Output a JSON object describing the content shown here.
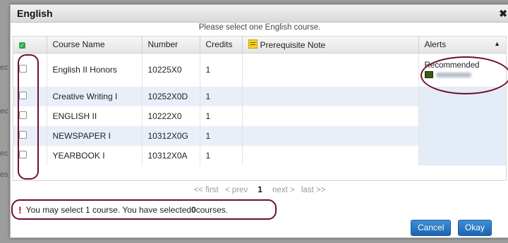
{
  "dialog": {
    "title": "English",
    "close_symbol": "✖",
    "instruction": "Please select one English course."
  },
  "table": {
    "headers": {
      "course_name": "Course Name",
      "number": "Number",
      "credits": "Credits",
      "prerequisite_note": "Prerequisite Note",
      "alerts": "Alerts"
    },
    "rows": [
      {
        "name": "English II Honors",
        "number": "10225X0",
        "credits": "1",
        "checked": false,
        "alert": "Recommended"
      },
      {
        "name": "Creative Writing I",
        "number": "10252X0D",
        "credits": "1",
        "checked": false,
        "alert": ""
      },
      {
        "name": "ENGLISH II",
        "number": "10222X0",
        "credits": "1",
        "checked": false,
        "alert": ""
      },
      {
        "name": "NEWSPAPER I",
        "number": "10312X0G",
        "credits": "1",
        "checked": false,
        "alert": ""
      },
      {
        "name": "YEARBOOK I",
        "number": "10312X0A",
        "credits": "1",
        "checked": false,
        "alert": ""
      }
    ]
  },
  "pager": {
    "first": "<< first",
    "prev": "< prev",
    "current": "1",
    "next": "next >",
    "last": "last >>"
  },
  "message": {
    "bang": "!",
    "text_before": "You may select 1 course. You have selected ",
    "selected_count": "0",
    "text_after": " courses."
  },
  "buttons": {
    "cancel": "Cancel",
    "okay": "Okay"
  },
  "colors": {
    "accent_blue": "#1c64b1",
    "annotation": "#6b1030",
    "alt_row": "#e8eff8",
    "warning_red": "#d10000"
  }
}
